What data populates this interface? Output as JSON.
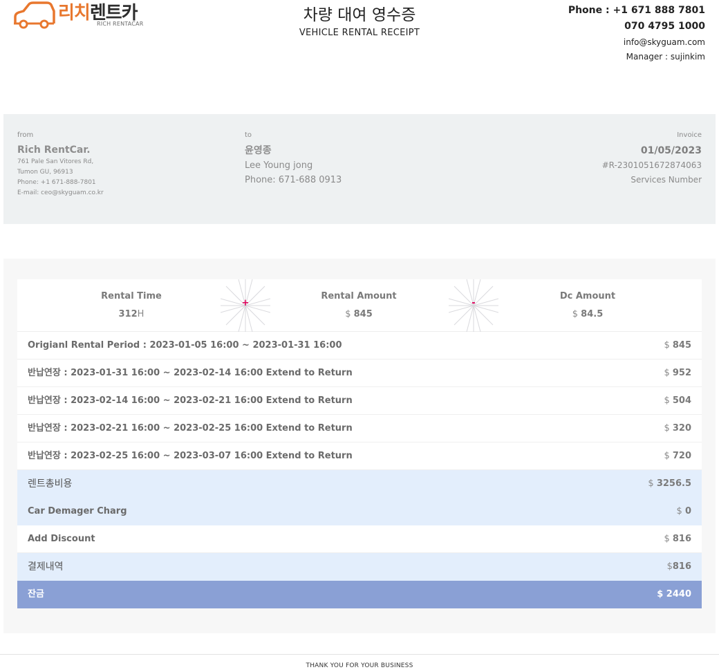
{
  "brand": {
    "name_ko_orange": "리치",
    "name_ko_dark": "렌트카",
    "name_en": "RICH RENTACAR",
    "orange": "#e8772e"
  },
  "header": {
    "title_ko": "차량 대여 영수증",
    "title_en": "VEHICLE RENTAL RECEIPT"
  },
  "contact": {
    "phone1": "Phone : +1 671 888 7801",
    "phone2": "070 4795 1000",
    "email": "info@skyguam.com",
    "manager": "Manager : sujinkim"
  },
  "from": {
    "label": "from",
    "name": "Rich RentCar.",
    "address1": "761 Pale San Vitores Rd,",
    "address2": "Tumon GU, 96913",
    "phone": "Phone: +1 671-888-7801",
    "email": "E-mail: ceo@skyguam.co.kr"
  },
  "to": {
    "label": "to",
    "name_ko": "윤영종",
    "name_en": "Lee Young jong",
    "phone": "Phone: 671-688 0913"
  },
  "invoice": {
    "label": "Invoice",
    "date": "01/05/2023",
    "number": "#R-2301051672874063",
    "services_label": "Services Number"
  },
  "summary": {
    "rental_time_label": "Rental Time",
    "rental_time_value": "312",
    "rental_time_unit": "H",
    "plus": "+",
    "rental_amount_label": "Rental Amount",
    "currency": "$",
    "rental_amount_value": "845",
    "minus": "-",
    "dc_amount_label": "Dc Amount",
    "dc_amount_value": "84.5"
  },
  "rows": [
    {
      "desc": "Origianl Rental Period : 2023-01-05 16:00 ~ 2023-01-31 16:00",
      "amount": "845"
    },
    {
      "desc": "반납연장 : 2023-01-31 16:00 ~ 2023-02-14 16:00 Extend to Return",
      "amount": "952"
    },
    {
      "desc": "반납연장 : 2023-02-14 16:00 ~ 2023-02-21 16:00 Extend to Return",
      "amount": "504"
    },
    {
      "desc": "반납연장 : 2023-02-21 16:00 ~ 2023-02-25 16:00 Extend to Return",
      "amount": "320"
    },
    {
      "desc": "반납연장 : 2023-02-25 16:00 ~ 2023-03-07 16:00 Extend to Return",
      "amount": "720"
    }
  ],
  "totals": {
    "rent_total_label": "렌트총비용",
    "rent_total_amount": "3256.5",
    "damage_label": "Car Demager Charg",
    "damage_amount": "0",
    "discount_label": "Add Discount",
    "discount_amount": "816",
    "payment_label": "결제내역",
    "payment_currency": "$",
    "payment_amount": "816",
    "balance_label": "잔금",
    "balance_amount": "$ 2440"
  },
  "footer": {
    "text": "THANK YOU FOR YOUR BUSINESS"
  },
  "colors": {
    "panel_gray": "#eef1f2",
    "light_blue": "#e3eefc",
    "total_blue": "#8aa0d5",
    "operator_red": "#e0005a"
  }
}
